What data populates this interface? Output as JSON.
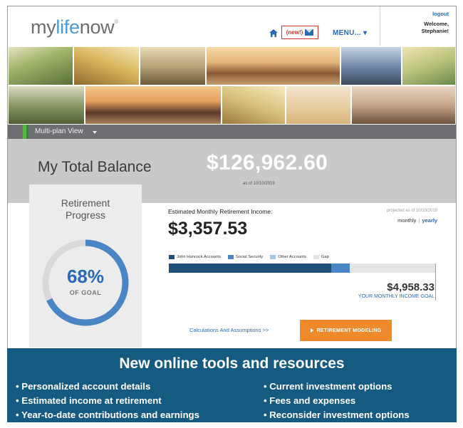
{
  "header": {
    "logo_prefix": "my",
    "logo_mid": "life",
    "logo_suffix": "now",
    "logo_mark": "®",
    "new_badge": "(new!)",
    "menu_label": "MENU...",
    "logout": "logout",
    "welcome_line1": "Welcome,",
    "welcome_line2": "Stephanie!"
  },
  "plan_bar": {
    "label": "Multi-plan View"
  },
  "balance": {
    "title": "My Total Balance",
    "amount": "$126,962.60",
    "as_of": "as of 10/10/2019"
  },
  "progress": {
    "title_line1": "Retirement",
    "title_line2": "Progress",
    "percent_label": "68%",
    "percent_value": 68,
    "goal_label": "OF GOAL"
  },
  "income": {
    "label": "Estimated Monthly Retirement Income:",
    "value": "$3,357.53",
    "projected": "projected as of 10/10/2019",
    "monthly": "monthly",
    "separator": "|",
    "yearly": "yearly",
    "legend": [
      {
        "label": "John Hancock Accounts",
        "color": "#1f4e79"
      },
      {
        "label": "Social Security",
        "color": "#4a86c5"
      },
      {
        "label": "Other Accounts",
        "color": "#a9c6e3"
      },
      {
        "label": "Gap",
        "color": "#e4e4e4"
      }
    ],
    "bar_shares": [
      0.61,
      0.07,
      0.0,
      0.32
    ],
    "goal_value": "$4,958.33",
    "goal_label": "YOUR MONTHLY INCOME GOAL",
    "calc_link": "Calculations And Assumptions >>",
    "modeling_button": "RETIREMENT MODELING"
  },
  "banner": {
    "title": "New online tools and resources",
    "left": [
      "• Personalized account details",
      "• Estimated income at retirement",
      "• Year-to-date contributions and earnings"
    ],
    "right": [
      "• Current investment options",
      "• Fees and expenses",
      "• Reconsider investment options"
    ]
  },
  "colors": {
    "brand_blue": "#2a6ab5",
    "accent_orange": "#ee8a2c",
    "banner_blue": "#155a80",
    "plan_green": "#5bb544"
  }
}
